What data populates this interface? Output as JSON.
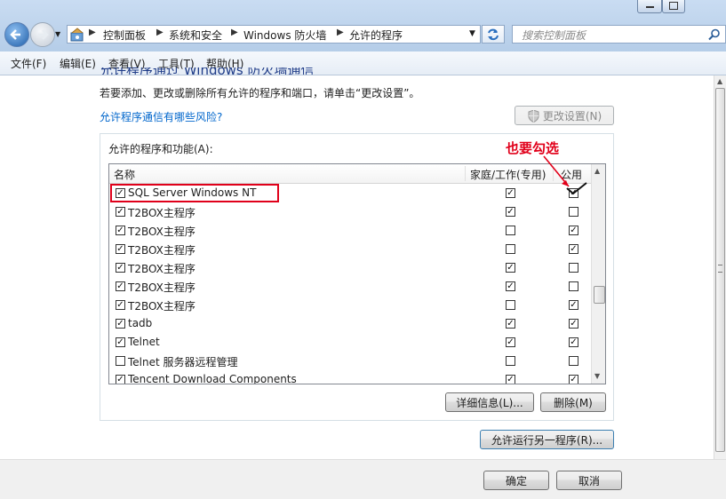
{
  "window": {
    "minimize_icon": "minimize-icon",
    "maximize_icon": "maximize-icon"
  },
  "address": {
    "crumbs": [
      "控制面板",
      "系统和安全",
      "Windows 防火墙",
      "允许的程序"
    ],
    "search_placeholder": "搜索控制面板"
  },
  "menu": [
    "文件(F)",
    "编辑(E)",
    "查看(V)",
    "工具(T)",
    "帮助(H)"
  ],
  "heading_partial": "允许程序通过 Windows 防火墙通信",
  "description": "若要添加、更改或删除所有允许的程序和端口，请单击“更改设置”。",
  "risk_link": "允许程序通信有哪些风险?",
  "change_settings_button": "更改设置(N)",
  "group_label": "允许的程序和功能(A):",
  "columns": {
    "name": "名称",
    "home": "家庭/工作(专用)",
    "public": "公用"
  },
  "rows": [
    {
      "name": "SQL Server Windows NT",
      "enabled": true,
      "home": true,
      "public": true
    },
    {
      "name": "T2BOX主程序",
      "enabled": true,
      "home": true,
      "public": false
    },
    {
      "name": "T2BOX主程序",
      "enabled": true,
      "home": false,
      "public": true
    },
    {
      "name": "T2BOX主程序",
      "enabled": true,
      "home": false,
      "public": true
    },
    {
      "name": "T2BOX主程序",
      "enabled": true,
      "home": true,
      "public": false
    },
    {
      "name": "T2BOX主程序",
      "enabled": true,
      "home": true,
      "public": false
    },
    {
      "name": "T2BOX主程序",
      "enabled": true,
      "home": false,
      "public": true
    },
    {
      "name": "tadb",
      "enabled": true,
      "home": true,
      "public": true
    },
    {
      "name": "Telnet",
      "enabled": true,
      "home": true,
      "public": true
    },
    {
      "name": "Telnet 服务器远程管理",
      "enabled": false,
      "home": false,
      "public": false
    },
    {
      "name": "Tencent Download Components",
      "enabled": true,
      "home": true,
      "public": true
    }
  ],
  "details_button": "详细信息(L)...",
  "remove_button": "删除(M)",
  "allow_another_button": "允许运行另一程序(R)...",
  "ok_button": "确定",
  "cancel_button": "取消",
  "annotation": "也要勾选",
  "colors": {
    "annotation": "#e1001a",
    "link": "#0066cc"
  }
}
